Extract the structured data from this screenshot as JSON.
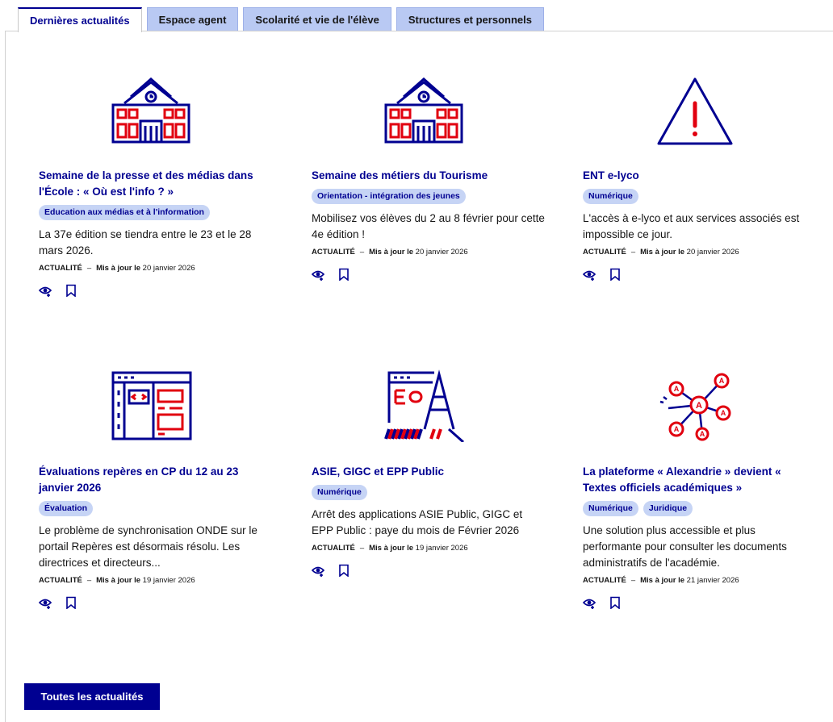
{
  "tabs": [
    {
      "label": "Dernières actualités",
      "active": true
    },
    {
      "label": "Espace agent",
      "active": false
    },
    {
      "label": "Scolarité et vie de l'élève",
      "active": false
    },
    {
      "label": "Structures et personnels",
      "active": false
    }
  ],
  "colors": {
    "primary": "#000091",
    "accent": "#e1000f",
    "tag_bg": "#c6d4f5",
    "tab_bg": "#b9c9f3"
  },
  "cards": [
    {
      "icon": "school-building-icon",
      "title": "Semaine de la presse et des médias dans l'École : « Où est l'info ? »",
      "tags": [
        "Education aux médias et à l'information"
      ],
      "description": "La 37e édition se tiendra entre le 23 et le 28 mars 2026.",
      "type": "ACTUALITÉ",
      "separator": "–",
      "updated_label": "Mis à jour le",
      "date": "20 janvier 2026"
    },
    {
      "icon": "school-building-icon",
      "title": "Semaine des métiers du Tourisme",
      "tags": [
        "Orientation - intégration des jeunes"
      ],
      "description": "Mobilisez vos élèves du 2 au 8 février pour cette 4e édition !",
      "type": "ACTUALITÉ",
      "separator": "–",
      "updated_label": "Mis à jour le",
      "date": "20 janvier 2026"
    },
    {
      "icon": "warning-triangle-icon",
      "title": "ENT e-lyco",
      "tags": [
        "Numérique"
      ],
      "description": "L'accès à e-lyco et aux services associés est impossible ce jour.",
      "type": "ACTUALITÉ",
      "separator": "–",
      "updated_label": "Mis à jour le",
      "date": "20 janvier 2026"
    },
    {
      "icon": "code-window-icon",
      "title": "Évaluations repères en CP du 12 au 23 janvier 2026",
      "tags": [
        "Évaluation"
      ],
      "description": "Le problème de synchronisation ONDE sur le portail Repères est désormais résolu. Les directrices et directeurs...",
      "type": "ACTUALITÉ",
      "separator": "–",
      "updated_label": "Mis à jour le",
      "date": "19 janvier 2026"
    },
    {
      "icon": "construction-barrier-icon",
      "title": "ASIE, GIGC et EPP Public",
      "tags": [
        "Numérique"
      ],
      "description": "Arrêt des applications ASIE Public, GIGC et EPP Public : paye du mois de Février 2026",
      "type": "ACTUALITÉ",
      "separator": "–",
      "updated_label": "Mis à jour le",
      "date": "19 janvier 2026"
    },
    {
      "icon": "network-nodes-icon",
      "title": "La plateforme « Alexandrie » devient « Textes officiels académiques »",
      "tags": [
        "Numérique",
        "Juridique"
      ],
      "description": "Une solution plus accessible et plus performante pour consulter les documents administratifs de l'académie.",
      "type": "ACTUALITÉ",
      "separator": "–",
      "updated_label": "Mis à jour le",
      "date": "21 janvier 2026"
    }
  ],
  "all_news_button": "Toutes les actualités"
}
